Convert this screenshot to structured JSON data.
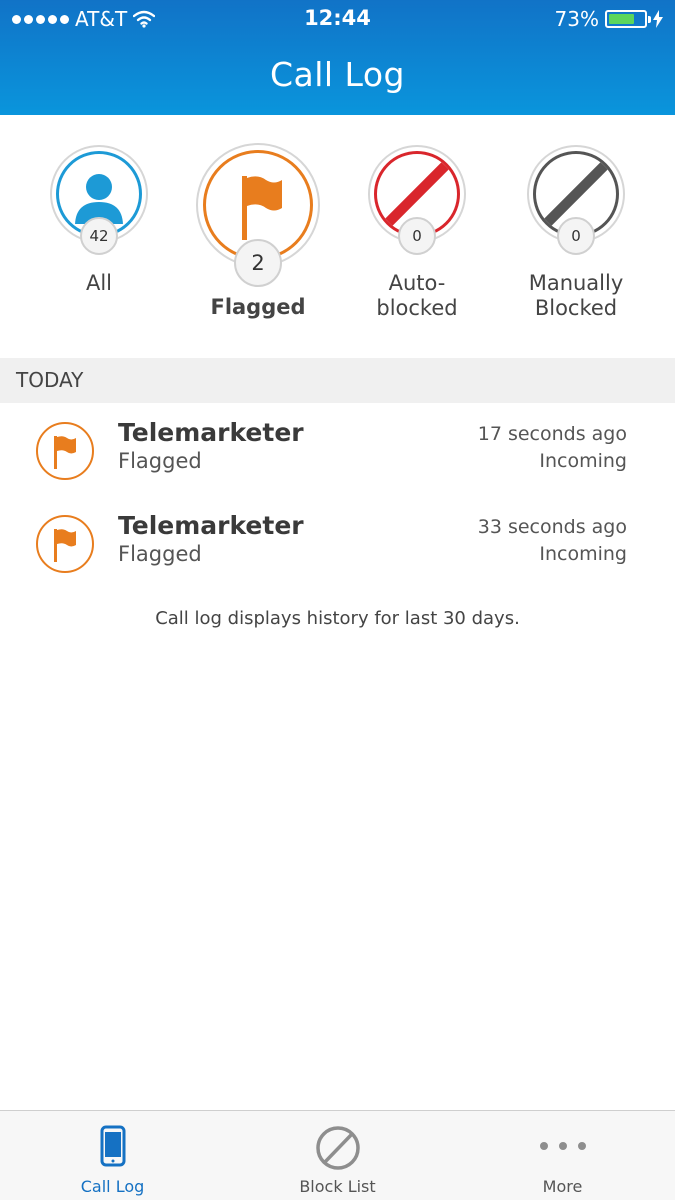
{
  "status_bar": {
    "carrier": "AT&T",
    "time": "12:44",
    "battery": "73%",
    "battery_level": 0.73
  },
  "header": {
    "title": "Call Log"
  },
  "filters": [
    {
      "label": "All",
      "count": "42",
      "icon": "person-icon",
      "color": "#1d9ad6"
    },
    {
      "label": "Flagged",
      "count": "2",
      "icon": "flag-icon",
      "color": "#e87d1e",
      "selected": true
    },
    {
      "label_line1": "Auto-",
      "label_line2": "blocked",
      "count": "0",
      "icon": "blocked-icon",
      "color": "#d9262c"
    },
    {
      "label_line1": "Manually",
      "label_line2": "Blocked",
      "count": "0",
      "icon": "blocked-icon",
      "color": "#555555"
    }
  ],
  "section": {
    "title": "TODAY"
  },
  "calls": [
    {
      "name": "Telemarketer",
      "status": "Flagged",
      "time": "17 seconds ago",
      "direction": "Incoming"
    },
    {
      "name": "Telemarketer",
      "status": "Flagged",
      "time": "33 seconds ago",
      "direction": "Incoming"
    }
  ],
  "footnote": "Call log displays history for last 30 days.",
  "tabbar": {
    "tabs": [
      {
        "label": "Call Log",
        "icon": "phone-icon",
        "active": true
      },
      {
        "label": "Block List",
        "icon": "block-icon"
      },
      {
        "label": "More",
        "icon": "more-icon"
      }
    ],
    "active_color": "#1571c3"
  }
}
